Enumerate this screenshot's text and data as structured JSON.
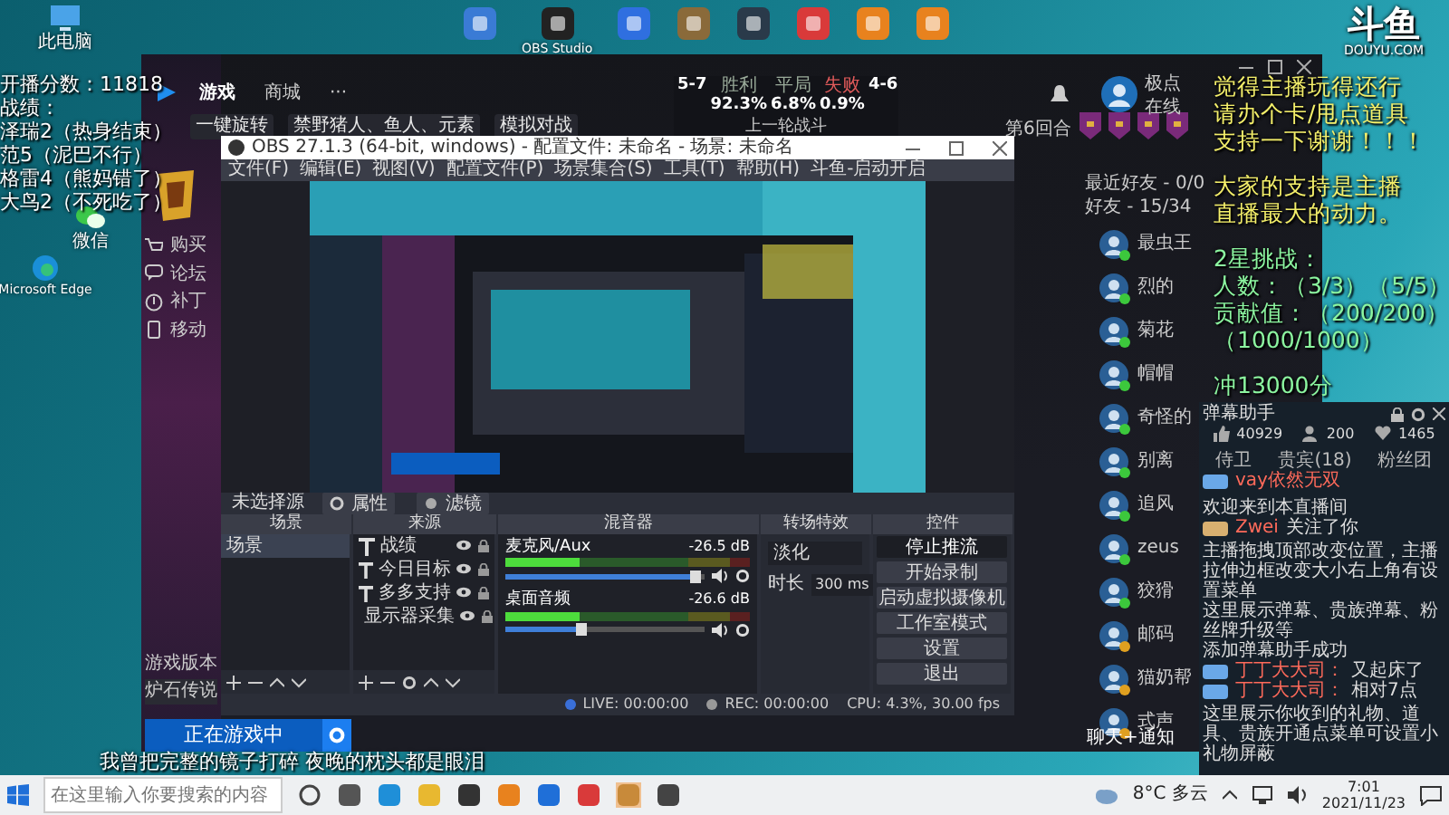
{
  "desktop": {
    "icons": [
      {
        "label": "此电脑",
        "kind": "computer"
      },
      {
        "label": "微信",
        "kind": "chat"
      },
      {
        "label": "Microsoft Edge",
        "kind": "browser"
      }
    ],
    "shortcuts": [
      {
        "color": "#3a7bd5"
      },
      {
        "color": "#222222"
      },
      {
        "color": "#2f6fe0"
      },
      {
        "color": "#8a6a3a"
      },
      {
        "color": "#2a3a4a"
      },
      {
        "color": "#d93a3a"
      },
      {
        "color": "#e8821e"
      },
      {
        "color": "#e8821e"
      }
    ],
    "obs_shortcut": {
      "label": "OBS Studio"
    }
  },
  "overlay": {
    "score_lines": [
      "开播分数：11818",
      "战绩：",
      "泽瑞2（热身结束）",
      "范5（泥巴不行）",
      "格雷4（熊妈错了）",
      "大鸟2（不死吃了）"
    ],
    "notice_lines": [
      "觉得主播玩得还行",
      "请办个卡/甩点道具",
      "支持一下谢谢！！！"
    ],
    "support_lines": [
      "大家的支持是主播",
      "直播最大的动力。"
    ],
    "challenge_lines": [
      "2星挑战：",
      "人数：（3/3）（5/5）",
      "贡献值：（200/200）",
      "（1000/1000）"
    ],
    "goal": "冲13000分",
    "logo": {
      "mark": "斗鱼",
      "site": "DOUYU.COM"
    },
    "subtitle": "我曾把完整的镜子打碎 夜晚的枕头都是眼泪"
  },
  "game_client": {
    "nav": [
      {
        "label": "游戏",
        "selected": true
      },
      {
        "label": "商城",
        "selected": false
      },
      {
        "label": "···",
        "selected": false
      }
    ],
    "sub_nav": [
      "一键旋转",
      "禁野猪人、鱼人、元素",
      "模拟对战"
    ],
    "side_menu": [
      {
        "label": "购买",
        "kind": "cart"
      },
      {
        "label": "论坛",
        "kind": "chat"
      },
      {
        "label": "补丁",
        "kind": "info"
      },
      {
        "label": "移动",
        "kind": "phone"
      }
    ],
    "stats": {
      "left_record": "5-7",
      "cells": [
        {
          "label": "胜利",
          "value": "92.3%"
        },
        {
          "label": "平局",
          "value": "6.8%"
        },
        {
          "label": "失败",
          "value": "0.9%"
        }
      ],
      "right_record": "4-6",
      "caption": "上一轮战斗"
    },
    "round": "第6回合",
    "user": {
      "name": "极点",
      "status": "在线"
    },
    "friend_groups": [
      "最近好友 - 0/0",
      "好友 - 15/34"
    ],
    "friends": [
      {
        "name": "最虫王",
        "color": "#3cc83c"
      },
      {
        "name": "烈的",
        "color": "#3cc83c"
      },
      {
        "name": "菊花",
        "color": "#3cc83c"
      },
      {
        "name": "帽帽",
        "color": "#3cc83c"
      },
      {
        "name": "奇怪的",
        "color": "#3cc83c"
      },
      {
        "name": "别离",
        "color": "#3cc83c"
      },
      {
        "name": "追风",
        "color": "#3cc83c"
      },
      {
        "name": "zeus",
        "color": "#3cc83c"
      },
      {
        "name": "狡猾",
        "color": "#3cc83c"
      },
      {
        "name": "邮码",
        "color": "#e0a020"
      },
      {
        "name": "猫奶帮",
        "color": "#e0a020"
      },
      {
        "name": "式声",
        "color": "#e0a020"
      }
    ],
    "version_label": "游戏版本",
    "game_select": "炉石传说",
    "play_button": "正在游戏中",
    "chat_tab": "聊天+通知"
  },
  "obs": {
    "title": "OBS 27.1.3 (64-bit, windows) - 配置文件: 未命名 - 场景: 未命名",
    "menu": [
      "文件(F)",
      "编辑(E)",
      "视图(V)",
      "配置文件(P)",
      "场景集合(S)",
      "工具(T)",
      "帮助(H)",
      "斗鱼-启动开启"
    ],
    "source_label": "未选择源",
    "source_buttons": [
      "属性",
      "滤镜"
    ],
    "panels": [
      "场景",
      "来源",
      "混音器",
      "转场特效",
      "控件"
    ],
    "scenes": [
      {
        "name": "场景",
        "selected": true
      }
    ],
    "sources": [
      {
        "name": "战绩",
        "kind": "text"
      },
      {
        "name": "今日目标",
        "kind": "text"
      },
      {
        "name": "多多支持",
        "kind": "text"
      },
      {
        "name": "显示器采集",
        "kind": "display"
      }
    ],
    "mixer": [
      {
        "name": "麦克风/Aux",
        "reading": "-26.5 dB",
        "meter": {
          "level": 0.3
        },
        "volume": {
          "level": 0.95
        }
      },
      {
        "name": "桌面音频",
        "reading": "-26.6 dB",
        "meter": {
          "level": 0.3
        },
        "volume": {
          "level": 0.38
        }
      }
    ],
    "transition": {
      "type": "淡化",
      "duration_label": "时长",
      "duration": "300 ms"
    },
    "controls": [
      {
        "label": "停止推流",
        "active": true
      },
      {
        "label": "开始录制",
        "active": false
      },
      {
        "label": "启动虚拟摄像机",
        "active": false
      },
      {
        "label": "工作室模式",
        "active": false
      },
      {
        "label": "设置",
        "active": false
      },
      {
        "label": "退出",
        "active": false
      }
    ],
    "status": [
      "LIVE: 00:00:00",
      "REC: 00:00:00",
      "CPU: 4.3%, 30.00 fps"
    ]
  },
  "danmu": {
    "title": "弹幕助手",
    "stats": [
      {
        "kind": "like",
        "value": "40929"
      },
      {
        "kind": "people",
        "value": "200"
      },
      {
        "kind": "heart",
        "value": "1465"
      }
    ],
    "tabs": [
      "侍卫",
      "贵宾(18)",
      "粉丝团"
    ],
    "messages": [
      {
        "kind": "chat",
        "user": "vay依然无双",
        "text": "欢迎来到本直播间"
      },
      {
        "kind": "chat",
        "user": "Zwei",
        "text": "关注了你"
      },
      {
        "kind": "system",
        "text": "主播拖拽顶部改变位置，主播拉伸边框改变大小右上角有设置菜单"
      },
      {
        "kind": "system",
        "text": "这里展示弹幕、贵族弹幕、粉丝牌升级等"
      },
      {
        "kind": "system",
        "text": "添加弹幕助手成功"
      },
      {
        "kind": "chat",
        "user": "丁丁大大司：",
        "text": "又起床了"
      },
      {
        "kind": "chat",
        "user": "丁丁大大司：",
        "text": "相对7点"
      },
      {
        "kind": "system",
        "text": "这里展示你收到的礼物、道具、贵族开通点菜单可设置小礼物屏蔽"
      }
    ]
  },
  "taskbar": {
    "search_placeholder": "在这里输入你要搜索的内容",
    "weather": "8°C 多云",
    "time": "7:01",
    "date": "2021/11/23"
  }
}
